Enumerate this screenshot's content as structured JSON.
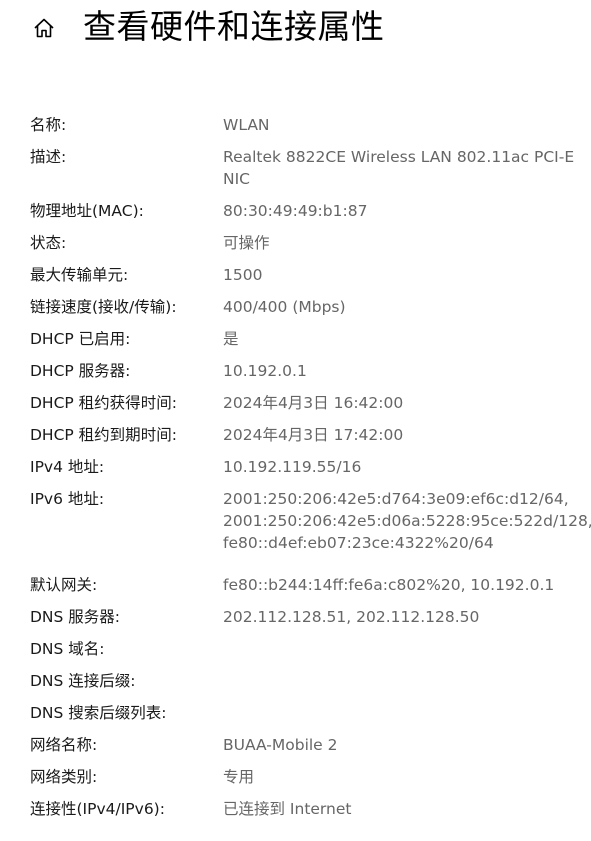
{
  "header": {
    "title": "查看硬件和连接属性",
    "home_icon": "home-icon"
  },
  "properties": [
    {
      "label": "名称:",
      "value_lines": [
        "WLAN"
      ]
    },
    {
      "label": "描述:",
      "value_lines": [
        "Realtek 8822CE Wireless LAN 802.11ac PCI-E",
        "NIC"
      ]
    },
    {
      "label": "物理地址(MAC):",
      "value_lines": [
        "80:30:49:49:b1:87"
      ]
    },
    {
      "label": "状态:",
      "value_lines": [
        "可操作"
      ]
    },
    {
      "label": "最大传输单元:",
      "value_lines": [
        "1500"
      ]
    },
    {
      "label": "链接速度(接收/传输):",
      "value_lines": [
        "400/400 (Mbps)"
      ]
    },
    {
      "label": "DHCP 已启用:",
      "value_lines": [
        "是"
      ]
    },
    {
      "label": "DHCP 服务器:",
      "value_lines": [
        "10.192.0.1"
      ]
    },
    {
      "label": "DHCP 租约获得时间:",
      "value_lines": [
        "2024年4月3日 16:42:00"
      ]
    },
    {
      "label": "DHCP 租约到期时间:",
      "value_lines": [
        "2024年4月3日 17:42:00"
      ]
    },
    {
      "label": "IPv4 地址:",
      "value_lines": [
        "10.192.119.55/16"
      ]
    },
    {
      "label": "IPv6 地址:",
      "value_lines": [
        "2001:250:206:42e5:d764:3e09:ef6c:d12/64,",
        "2001:250:206:42e5:d06a:5228:95ce:522d/128,",
        "fe80::d4ef:eb07:23ce:4322%20/64"
      ]
    },
    {
      "label": "默认网关:",
      "value_lines": [
        "fe80::b244:14ff:fe6a:c802%20, 10.192.0.1"
      ]
    },
    {
      "label": "DNS 服务器:",
      "value_lines": [
        "202.112.128.51, 202.112.128.50"
      ]
    },
    {
      "label": "DNS 域名:",
      "value_lines": []
    },
    {
      "label": "DNS 连接后缀:",
      "value_lines": []
    },
    {
      "label": "DNS 搜索后缀列表:",
      "value_lines": []
    },
    {
      "label": "网络名称:",
      "value_lines": [
        "BUAA-Mobile 2"
      ]
    },
    {
      "label": "网络类别:",
      "value_lines": [
        "专用"
      ]
    },
    {
      "label": "连接性(IPv4/IPv6):",
      "value_lines": [
        "已连接到 Internet"
      ]
    }
  ]
}
